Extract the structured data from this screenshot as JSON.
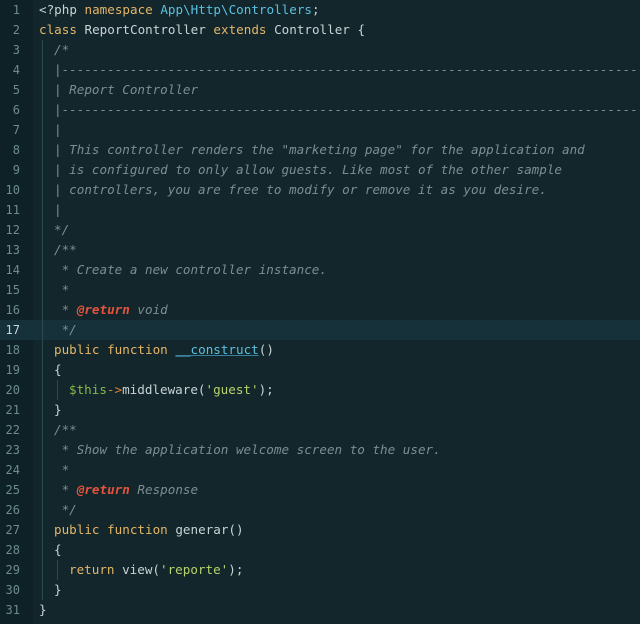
{
  "editor": {
    "active_line": 17,
    "lines": [
      {
        "n": "1",
        "indent": 0,
        "tokens": [
          {
            "c": "plain",
            "t": "<?php "
          },
          {
            "c": "kw",
            "t": "namespace"
          },
          {
            "c": "plain",
            "t": " "
          },
          {
            "c": "ns",
            "t": "App\\Http\\Controllers"
          },
          {
            "c": "plain",
            "t": ";"
          }
        ]
      },
      {
        "n": "2",
        "indent": 0,
        "tokens": [
          {
            "c": "kw",
            "t": "class"
          },
          {
            "c": "plain",
            "t": " ReportController "
          },
          {
            "c": "kw",
            "t": "extends"
          },
          {
            "c": "plain",
            "t": " Controller {"
          }
        ]
      },
      {
        "n": "3",
        "indent": 1,
        "tokens": [
          {
            "c": "cm",
            "t": "/*"
          }
        ]
      },
      {
        "n": "4",
        "indent": 1,
        "tokens": [
          {
            "c": "cm",
            "t": "|-----------------------------------------------------------------------------"
          }
        ]
      },
      {
        "n": "5",
        "indent": 1,
        "tokens": [
          {
            "c": "cm",
            "t": "| Report Controller"
          }
        ]
      },
      {
        "n": "6",
        "indent": 1,
        "tokens": [
          {
            "c": "cm",
            "t": "|-----------------------------------------------------------------------------"
          }
        ]
      },
      {
        "n": "7",
        "indent": 1,
        "tokens": [
          {
            "c": "cm",
            "t": "|"
          }
        ]
      },
      {
        "n": "8",
        "indent": 1,
        "tokens": [
          {
            "c": "cm",
            "t": "| This controller renders the \"marketing page\" for the application and"
          }
        ]
      },
      {
        "n": "9",
        "indent": 1,
        "tokens": [
          {
            "c": "cm",
            "t": "| is configured to only allow guests. Like most of the other sample"
          }
        ]
      },
      {
        "n": "10",
        "indent": 1,
        "tokens": [
          {
            "c": "cm",
            "t": "| controllers, you are free to modify or remove it as you desire."
          }
        ]
      },
      {
        "n": "11",
        "indent": 1,
        "tokens": [
          {
            "c": "cm",
            "t": "|"
          }
        ]
      },
      {
        "n": "12",
        "indent": 1,
        "tokens": [
          {
            "c": "cm",
            "t": "*/"
          }
        ]
      },
      {
        "n": "13",
        "indent": 1,
        "tokens": [
          {
            "c": "cm",
            "t": "/**"
          }
        ]
      },
      {
        "n": "14",
        "indent": 1,
        "tokens": [
          {
            "c": "cm",
            "t": " * Create a new controller instance."
          }
        ]
      },
      {
        "n": "15",
        "indent": 1,
        "tokens": [
          {
            "c": "cm",
            "t": " *"
          }
        ]
      },
      {
        "n": "16",
        "indent": 1,
        "tokens": [
          {
            "c": "cm",
            "t": " * "
          },
          {
            "c": "tag",
            "t": "@return"
          },
          {
            "c": "cm",
            "t": " void"
          }
        ]
      },
      {
        "n": "17",
        "indent": 1,
        "tokens": [
          {
            "c": "cm",
            "t": " */"
          }
        ]
      },
      {
        "n": "18",
        "indent": 1,
        "tokens": [
          {
            "c": "kw",
            "t": "public"
          },
          {
            "c": "plain",
            "t": " "
          },
          {
            "c": "kw",
            "t": "function"
          },
          {
            "c": "plain",
            "t": " "
          },
          {
            "c": "fn",
            "t": "__construct"
          },
          {
            "c": "plain",
            "t": "()"
          }
        ]
      },
      {
        "n": "19",
        "indent": 1,
        "tokens": [
          {
            "c": "plain",
            "t": "{"
          }
        ]
      },
      {
        "n": "20",
        "indent": 2,
        "tokens": [
          {
            "c": "var",
            "t": "$this"
          },
          {
            "c": "op",
            "t": "->"
          },
          {
            "c": "plain",
            "t": "middleware("
          },
          {
            "c": "str",
            "t": "'guest'"
          },
          {
            "c": "plain",
            "t": ");"
          }
        ]
      },
      {
        "n": "21",
        "indent": 1,
        "tokens": [
          {
            "c": "plain",
            "t": "}"
          }
        ]
      },
      {
        "n": "22",
        "indent": 1,
        "tokens": [
          {
            "c": "cm",
            "t": "/**"
          }
        ]
      },
      {
        "n": "23",
        "indent": 1,
        "tokens": [
          {
            "c": "cm",
            "t": " * Show the application welcome screen to the user."
          }
        ]
      },
      {
        "n": "24",
        "indent": 1,
        "tokens": [
          {
            "c": "cm",
            "t": " *"
          }
        ]
      },
      {
        "n": "25",
        "indent": 1,
        "tokens": [
          {
            "c": "cm",
            "t": " * "
          },
          {
            "c": "tag",
            "t": "@return"
          },
          {
            "c": "cm",
            "t": " Response"
          }
        ]
      },
      {
        "n": "26",
        "indent": 1,
        "tokens": [
          {
            "c": "cm",
            "t": " */"
          }
        ]
      },
      {
        "n": "27",
        "indent": 1,
        "tokens": [
          {
            "c": "kw",
            "t": "public"
          },
          {
            "c": "plain",
            "t": " "
          },
          {
            "c": "kw",
            "t": "function"
          },
          {
            "c": "plain",
            "t": " generar()"
          }
        ]
      },
      {
        "n": "28",
        "indent": 1,
        "tokens": [
          {
            "c": "plain",
            "t": "{"
          }
        ]
      },
      {
        "n": "29",
        "indent": 2,
        "tokens": [
          {
            "c": "kw",
            "t": "return"
          },
          {
            "c": "plain",
            "t": " view("
          },
          {
            "c": "str",
            "t": "'reporte'"
          },
          {
            "c": "plain",
            "t": ");"
          }
        ]
      },
      {
        "n": "30",
        "indent": 1,
        "tokens": [
          {
            "c": "plain",
            "t": "}"
          }
        ]
      },
      {
        "n": "31",
        "indent": 0,
        "tokens": [
          {
            "c": "plain",
            "t": "}"
          }
        ]
      }
    ]
  }
}
